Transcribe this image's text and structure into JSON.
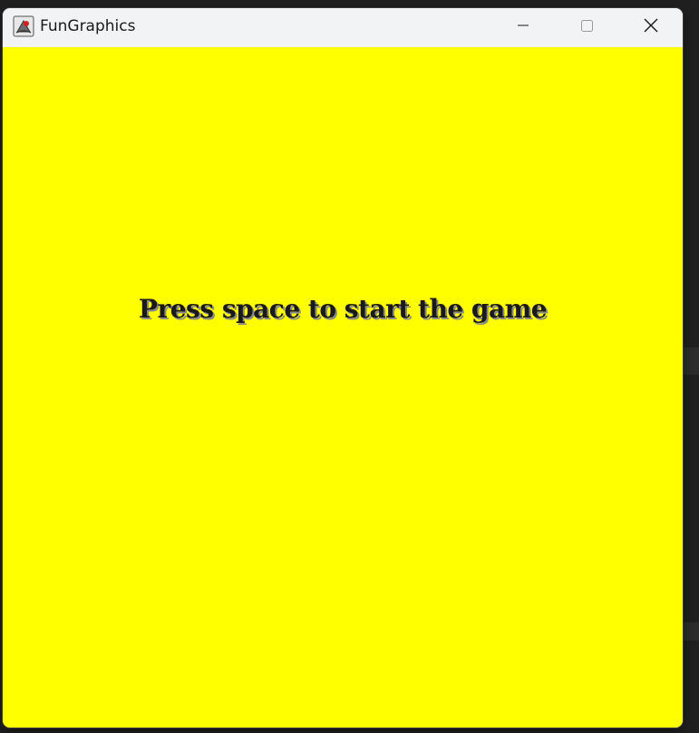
{
  "window": {
    "title": "FunGraphics",
    "app_icon": "java-cup-icon",
    "controls": {
      "minimize": "minimize-icon",
      "maximize": "maximize-icon",
      "close": "close-icon"
    }
  },
  "canvas": {
    "background": "#ffff00",
    "message": "Press space to start the game"
  }
}
